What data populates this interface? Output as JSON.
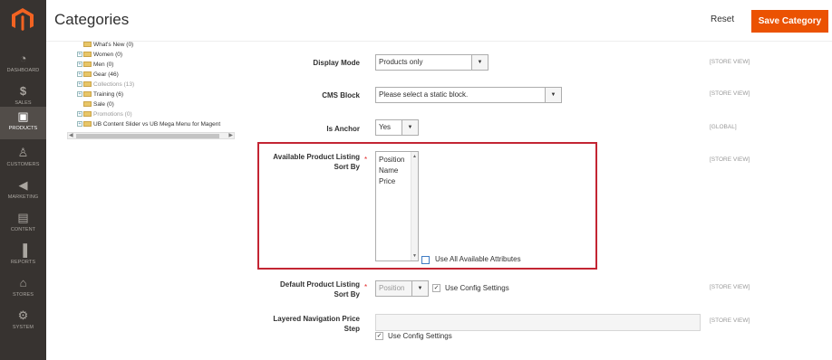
{
  "header": {
    "title": "Categories",
    "reset_label": "Reset",
    "save_label": "Save Category"
  },
  "sidebar": {
    "items": [
      {
        "label": "DASHBOARD",
        "icon": "dashboard-icon",
        "glyph": "◔"
      },
      {
        "label": "SALES",
        "icon": "dollar-icon",
        "glyph": "$"
      },
      {
        "label": "PRODUCTS",
        "icon": "cube-icon",
        "glyph": "▣"
      },
      {
        "label": "CUSTOMERS",
        "icon": "person-icon",
        "glyph": "♙"
      },
      {
        "label": "MARKETING",
        "icon": "megaphone-icon",
        "glyph": "◀"
      },
      {
        "label": "CONTENT",
        "icon": "content-icon",
        "glyph": "▤"
      },
      {
        "label": "REPORTS",
        "icon": "bar-chart-icon",
        "glyph": "▐"
      },
      {
        "label": "STORES",
        "icon": "store-icon",
        "glyph": "⌂"
      },
      {
        "label": "SYSTEM",
        "icon": "gear-icon",
        "glyph": "⚙"
      }
    ]
  },
  "tree": {
    "items": [
      {
        "label": "What's New (0)"
      },
      {
        "label": "Women (0)"
      },
      {
        "label": "Men (0)"
      },
      {
        "label": "Gear (46)"
      },
      {
        "label": "Collections (13)"
      },
      {
        "label": "Training (6)"
      },
      {
        "label": "Sale (0)"
      },
      {
        "label": "Promotions (0)"
      },
      {
        "label": "UB Content Slider vs UB Mega Menu for Magent"
      }
    ]
  },
  "form": {
    "display_mode": {
      "label": "Display Mode",
      "value": "Products only",
      "scope": "[STORE VIEW]"
    },
    "cms_block": {
      "label": "CMS Block",
      "value": "Please select a static block.",
      "scope": "[STORE VIEW]"
    },
    "is_anchor": {
      "label": "Is Anchor",
      "value": "Yes",
      "scope": "[GLOBAL]"
    },
    "sort_by": {
      "label_line1": "Available Product Listing",
      "label_line2": "Sort By",
      "options": [
        "Position",
        "Name",
        "Price"
      ],
      "use_all_label": "Use All Available Attributes",
      "scope": "[STORE VIEW]"
    },
    "default_sort": {
      "label_line1": "Default Product Listing",
      "label_line2": "Sort By",
      "value": "Position",
      "use_config_label": "Use Config Settings",
      "scope": "[STORE VIEW]"
    },
    "price_step": {
      "label_line1": "Layered Navigation Price",
      "label_line2": "Step",
      "use_config_label": "Use Config Settings",
      "scope": "[STORE VIEW]"
    }
  },
  "colors": {
    "accent": "#eb5202",
    "sidebar": "#373330",
    "highlight": "#c32533"
  }
}
